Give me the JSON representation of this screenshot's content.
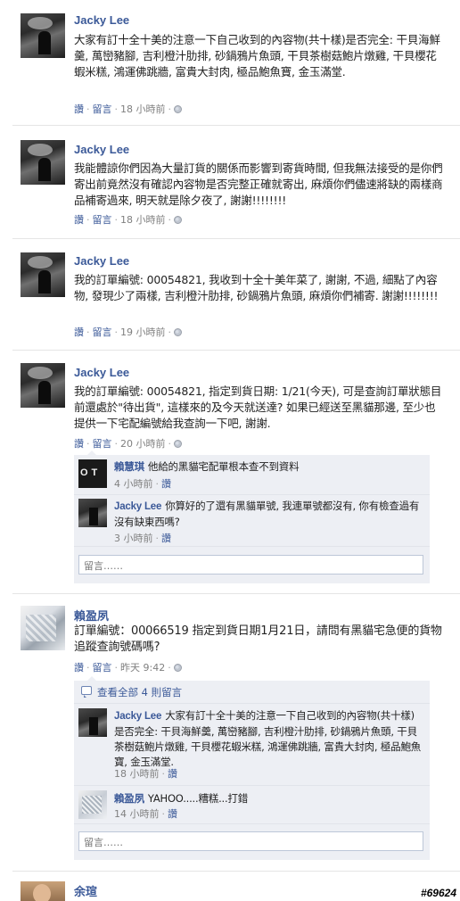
{
  "posts": [
    {
      "author": "Jacky Lee",
      "message": "大家有訂十全十美的注意一下自己收到的內容物(共十樣)是否完全: 干貝海鮮羹, 萬巒豬腳, 吉利橙汁肋排, 砂鍋鴉片魚頭, 干貝茶樹菇鮑片燉雞, 干貝櫻花蝦米糕, 鴻運佛跳牆, 富貴大封肉, 極品鮑魚寶, 金玉滿堂.",
      "meta": {
        "like": "讚",
        "comment": "留言",
        "time": "18 小時前"
      }
    },
    {
      "author": "Jacky Lee",
      "message": "我能體諒你們因為大量訂貨的關係而影響到寄貨時間, 但我無法接受的是你們寄出前竟然沒有確認內容物是否完整正確就寄出, 麻煩你們儘速將缺的兩樣商品補寄過來, 明天就是除夕夜了, 謝謝!!!!!!!!",
      "meta": {
        "like": "讚",
        "comment": "留言",
        "time": "18 小時前"
      }
    },
    {
      "author": "Jacky Lee",
      "message": "我的訂單編號: 00054821, 我收到十全十美年菜了, 謝謝, 不過, 細點了內容物, 發現少了兩樣, 吉利橙汁肋排, 砂鍋鴉片魚頭, 麻煩你們補寄. 謝謝!!!!!!!!",
      "meta": {
        "like": "讚",
        "comment": "留言",
        "time": "19 小時前"
      }
    },
    {
      "author": "Jacky Lee",
      "message": "我的訂單編號: 00054821, 指定到貨日期: 1/21(今天), 可是查詢訂單狀態目前還處於\"待出貨\", 這樣來的及今天就送達? 如果已經送至黑貓那邊, 至少也提供一下宅配編號給我查詢一下吧, 謝謝.",
      "meta": {
        "like": "讚",
        "comment": "留言",
        "time": "20 小時前"
      },
      "comments": [
        {
          "author": "賴慧琪",
          "text": "他給的黑貓宅配單根本查不到資料",
          "time": "4 小時前",
          "like": "讚"
        },
        {
          "author": "Jacky Lee",
          "text": "你算好的了還有黑貓單號, 我連單號都沒有, 你有檢查過有沒有缺東西嗎?",
          "time": "3 小時前",
          "like": "讚"
        }
      ],
      "comment_placeholder": "留言……"
    },
    {
      "author": "賴盈夙",
      "message": "訂單編號：00066519 指定到貨日期1月21日，請問有黑貓宅急便的貨物追蹤查詢號碼嗎?",
      "meta": {
        "like": "讚",
        "comment": "留言",
        "time": "昨天 9:42"
      },
      "view_all": "查看全部 4 則留言",
      "comments": [
        {
          "author": "Jacky Lee",
          "text": "大家有訂十全十美的注意一下自己收到的內容物(共十樣)是否完全: 干貝海鮮羹, 萬巒豬腳, 吉利橙汁肋排, 砂鍋鴉片魚頭, 干貝茶樹菇鮑片燉雞, 干貝櫻花蝦米糕, 鴻運佛跳牆, 富貴大封肉, 極品鮑魚寶, 金玉滿堂.",
          "time": "18 小時前",
          "like": "讚"
        },
        {
          "author": "賴盈夙",
          "text": "YAHOO.....糟糕...打錯",
          "time": "14 小時前",
          "like": "讚"
        }
      ],
      "comment_placeholder": "留言……"
    },
    {
      "author": "余瑄"
    }
  ],
  "watermark": "#69624"
}
